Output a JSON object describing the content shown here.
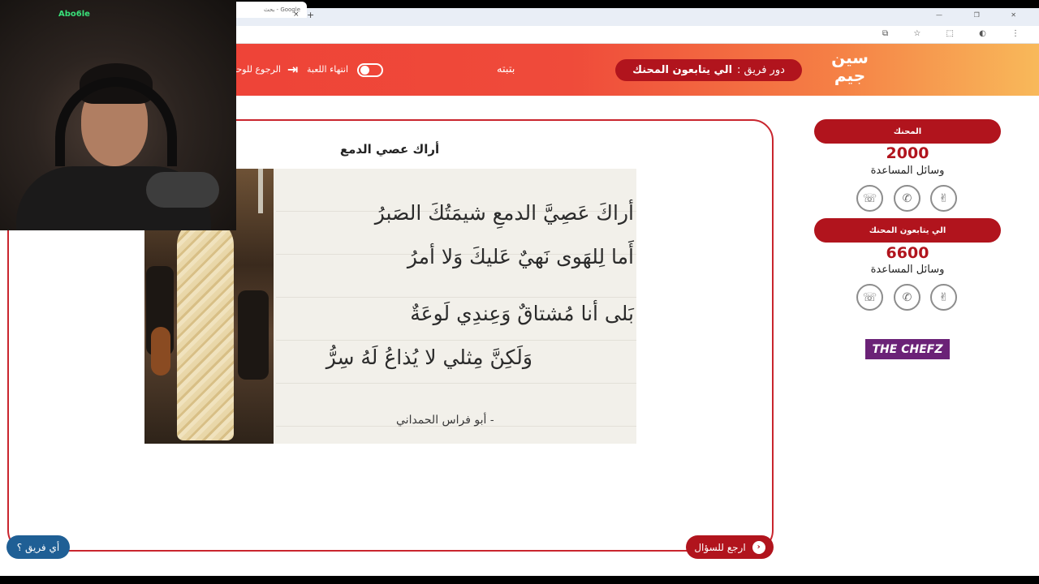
{
  "browser": {
    "tab_title": "Google - بحث",
    "tab_close": "×",
    "new_tab": "+",
    "window_controls": "— ❐ ✕",
    "address_icons": "⧉ ☆ ⬚ ◐ ⋮"
  },
  "webcam": {
    "streamer_name": "Abo6le"
  },
  "header": {
    "logo_text": "سين جيم",
    "turn_label": "دور فريق :",
    "turn_team": "الي يتابعون المحنك",
    "bettah": "بتبته",
    "end_game": "انتهاء اللعبة",
    "exit_icon": "⇥",
    "back_to_categories": "الرجوع للوحة"
  },
  "question": {
    "title": "أراك عصي الدمع",
    "poem_lines": [
      "أراكَ عَصِيَّ الدمعِ شيمَتُكَ الصَبرُ",
      "أَما لِلهَوى نَهيٌ عَليكَ وَلا أمرُ",
      "بَلى أنا مُشتاقٌ وَعِندِي لَوعَةٌ",
      "وَلَكِنَّ مِثلي لا يُذاعُ لَهُ سِرُّ"
    ],
    "author": "- أبو فراس الحمداني",
    "back_to_question": "ارجع للسؤال",
    "back_icon": "‹",
    "which_team": "أي فريق ؟"
  },
  "teams": [
    {
      "name": "المحنك",
      "score": "2000",
      "aids_label": "وسائل المساعدة"
    },
    {
      "name": "الي يتابعون المحنك",
      "score": "6600",
      "aids_label": "وسائل المساعدة"
    }
  ],
  "aid_icons": [
    "double-answer-icon",
    "phone-call-icon",
    "two-choices-icon"
  ],
  "aid_glyphs": [
    "☏",
    "✆",
    "✌"
  ],
  "sponsor": "THE CHEFZ",
  "colors": {
    "primary_red": "#b1141d",
    "header_gradient_start": "#ee3e36",
    "header_gradient_end": "#f8b95a",
    "which_team_blue": "#1f5f95",
    "sponsor_purple": "#6b2277"
  }
}
